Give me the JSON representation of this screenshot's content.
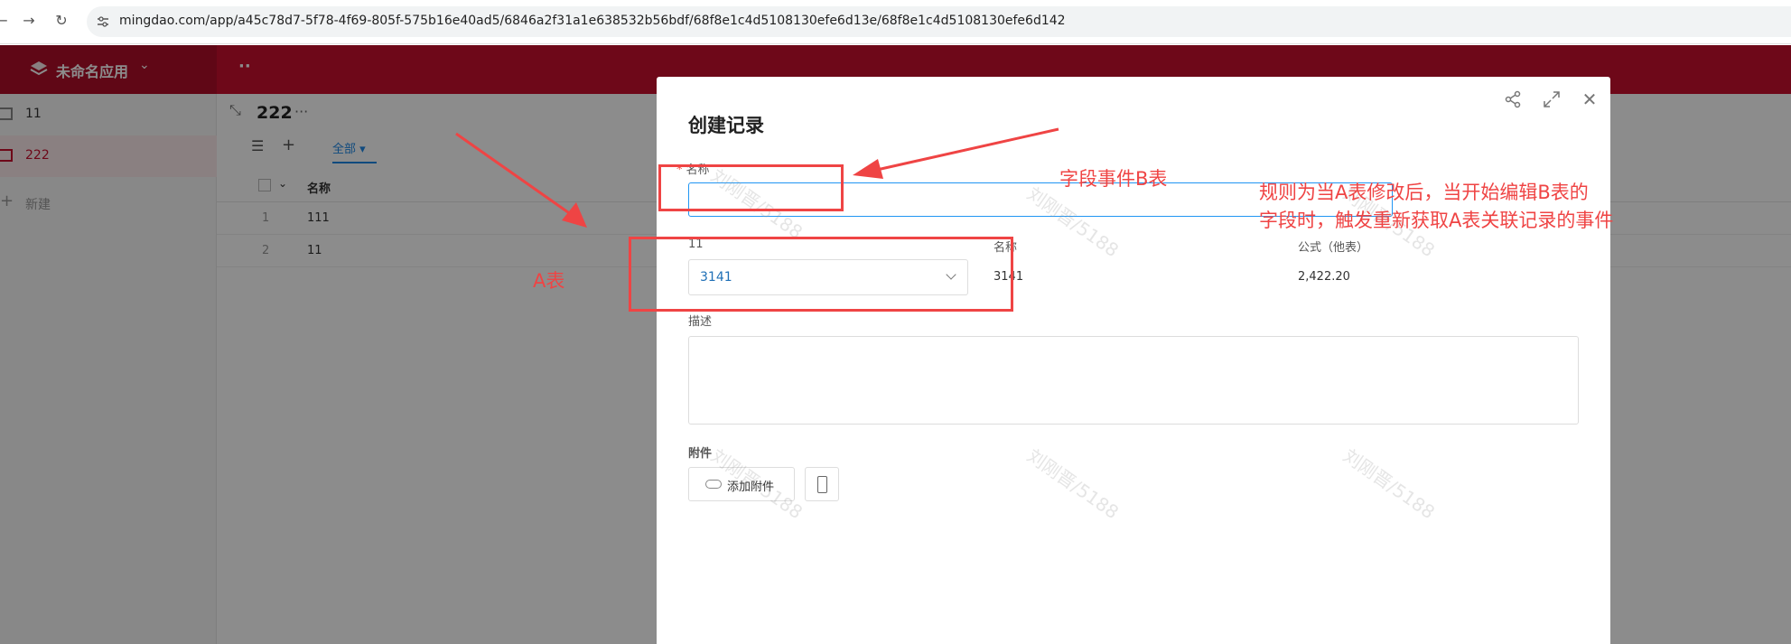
{
  "browser": {
    "url": "mingdao.com/app/a45c78d7-5f78-4f69-805f-575b16e40ad5/6846a2f31a1e638532b56bdf/68f8e1c4d5108130efe6d13e/68f8e1c4d5108130efe6d142",
    "back_glyph": "←",
    "forward_glyph": "→",
    "reload_glyph": "↻"
  },
  "app": {
    "name": "未命名应用",
    "header_more": "··",
    "sidebar": [
      {
        "label": "11",
        "active": false
      },
      {
        "label": "222",
        "active": true
      },
      {
        "label": "新建",
        "active": false
      }
    ],
    "worksheet_title": "222",
    "title_more": "···",
    "view_tab": "全部",
    "table": {
      "headers": [
        "名称"
      ],
      "rows": [
        {
          "index": "1",
          "name": "111"
        },
        {
          "index": "2",
          "name": "11"
        }
      ]
    }
  },
  "modal": {
    "title": "创建记录",
    "share_icon": "share-icon",
    "expand_icon": "expand-icon",
    "close_glyph": "✕",
    "fields": {
      "name_label": "名称",
      "name_value": "",
      "relation_label": "11",
      "relation_value": "3141",
      "lookup_name_label": "名称",
      "lookup_name_value": "3141",
      "formula_label": "公式（他表）",
      "formula_value": "2,422.20",
      "desc_label": "描述",
      "desc_value": "",
      "attach_label": "附件",
      "attach_button": "添加附件"
    }
  },
  "annotations": {
    "field_event": "字段事件B表",
    "table_a": "A表",
    "rule_line1": "规则为当A表修改后，当开始编辑B表的",
    "rule_line2": "字段时，触发重新获取A表关联记录的事件",
    "color": "#ef4444"
  },
  "watermark": "刘刚晋/5188"
}
